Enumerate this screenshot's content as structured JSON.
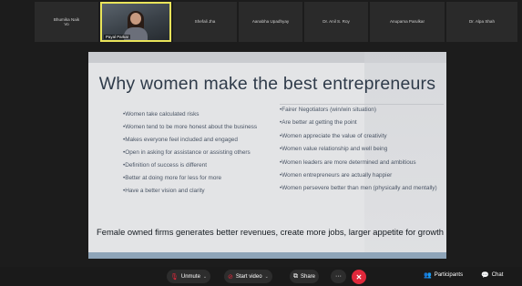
{
  "participants": [
    {
      "name": "Bhumika Naik",
      "sub": "Vo",
      "active": false
    },
    {
      "name": "Payal Parkar",
      "sub": "",
      "active": true
    },
    {
      "name": "Shefali Jha",
      "sub": "",
      "active": false
    },
    {
      "name": "Aanabha Upadhyay",
      "sub": "",
      "active": false
    },
    {
      "name": "Dr. Anil S. Roy",
      "sub": "",
      "active": false
    },
    {
      "name": "Anupama Parulkar",
      "sub": "",
      "active": false
    },
    {
      "name": "Dr. Alpa Shah",
      "sub": "",
      "active": false
    }
  ],
  "slide": {
    "title": "Why women make the best entrepreneurs",
    "left_bullets": [
      "•Women take calculated risks",
      "•Women tend to be more honest about the business",
      "•Makes everyone feel included and engaged",
      "•Open in asking for assistance or assisting others",
      "•Definition of success is different",
      "•Better at doing more for less for more",
      "•Have a better vision and clarity"
    ],
    "right_bullets": [
      "•Fairer Negotiators (win/win situation)",
      "•Are better at getting the point",
      "•Women appreciate the value of creativity",
      "•Women value relationship and well being",
      "•Women leaders are more determined and ambitious",
      "•Women entrepreneurs are actually happier",
      "•Women persevere better than men (physically and mentally)"
    ],
    "footer": "Female owned firms generates better revenues, create more jobs, larger appetite for growth"
  },
  "toolbar": {
    "unmute_label": "Unmute",
    "start_video_label": "Start video",
    "share_label": "Share",
    "more_label": "···",
    "participants_label": "Participants",
    "chat_label": "Chat"
  },
  "colors": {
    "leave_button": "#e0283b",
    "active_speaker_border": "#e9e45a",
    "mic_icon": "#e0283b"
  },
  "icons": {
    "unmute": "mic-muted-icon",
    "start_video": "video-off-icon",
    "share": "share-screen-icon",
    "leave": "leave-icon",
    "participants": "participants-icon",
    "chat": "chat-icon"
  }
}
